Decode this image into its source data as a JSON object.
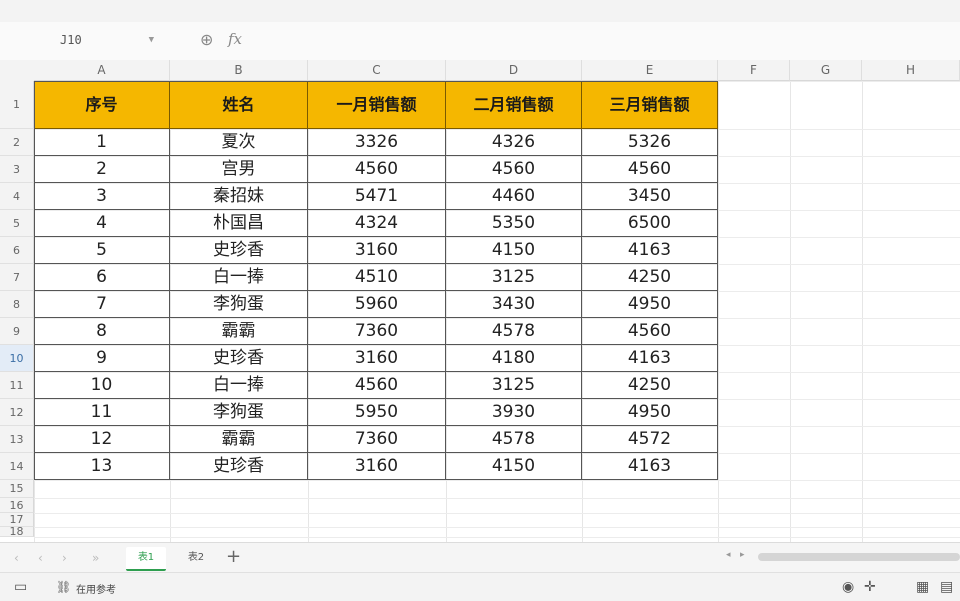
{
  "formula_bar": {
    "cell_ref": "J10",
    "fx_label": "fx"
  },
  "columns": [
    "A",
    "B",
    "C",
    "D",
    "E",
    "F",
    "G",
    "H"
  ],
  "rows": [
    "1",
    "2",
    "3",
    "4",
    "5",
    "6",
    "7",
    "8",
    "9",
    "10",
    "11",
    "12",
    "13",
    "14",
    "15",
    "16",
    "17",
    "18"
  ],
  "selected_row": "10",
  "table": {
    "headers": [
      "序号",
      "姓名",
      "一月销售额",
      "二月销售额",
      "三月销售额"
    ],
    "rows": [
      [
        "1",
        "夏次",
        "3326",
        "4326",
        "5326"
      ],
      [
        "2",
        "宫男",
        "4560",
        "4560",
        "4560"
      ],
      [
        "3",
        "秦招妹",
        "5471",
        "4460",
        "3450"
      ],
      [
        "4",
        "朴国昌",
        "4324",
        "5350",
        "6500"
      ],
      [
        "5",
        "史珍香",
        "3160",
        "4150",
        "4163"
      ],
      [
        "6",
        "白一捧",
        "4510",
        "3125",
        "4250"
      ],
      [
        "7",
        "李狗蛋",
        "5960",
        "3430",
        "4950"
      ],
      [
        "8",
        "霸霸",
        "7360",
        "4578",
        "4560"
      ],
      [
        "9",
        "史珍香",
        "3160",
        "4180",
        "4163"
      ],
      [
        "10",
        "白一捧",
        "4560",
        "3125",
        "4250"
      ],
      [
        "11",
        "李狗蛋",
        "5950",
        "3930",
        "4950"
      ],
      [
        "12",
        "霸霸",
        "7360",
        "4578",
        "4572"
      ],
      [
        "13",
        "史珍香",
        "3160",
        "4150",
        "4163"
      ]
    ]
  },
  "sheet_tabs": [
    "表1",
    "表2"
  ],
  "active_sheet": 0,
  "status": {
    "label": "在用参考"
  },
  "icons": {
    "zoom": "magnifier-icon",
    "add_sheet": "plus-icon",
    "nav": [
      "first-sheet-icon",
      "prev-sheet-icon",
      "next-sheet-icon"
    ]
  }
}
